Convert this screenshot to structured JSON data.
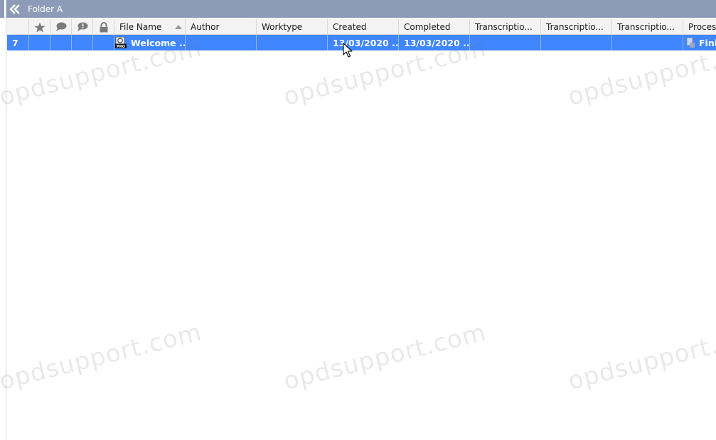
{
  "window": {
    "title": "Folder A"
  },
  "columns": [
    {
      "key": "index",
      "label": ""
    },
    {
      "key": "star",
      "label": "",
      "icon": "star-icon"
    },
    {
      "key": "comment",
      "label": "",
      "icon": "speech-bubble-icon"
    },
    {
      "key": "priority",
      "label": "",
      "icon": "exclamation-bubble-icon"
    },
    {
      "key": "lock",
      "label": "",
      "icon": "lock-icon"
    },
    {
      "key": "file_name",
      "label": "File Name"
    },
    {
      "key": "author",
      "label": "Author"
    },
    {
      "key": "worktype",
      "label": "Worktype"
    },
    {
      "key": "created",
      "label": "Created"
    },
    {
      "key": "completed",
      "label": "Completed"
    },
    {
      "key": "transcription1",
      "label": "Transcriptio..."
    },
    {
      "key": "transcription2",
      "label": "Transcriptio..."
    },
    {
      "key": "transcription3",
      "label": "Transcriptio..."
    },
    {
      "key": "process",
      "label": "Proces"
    }
  ],
  "rows": [
    {
      "index": "7",
      "file_name": "Welcome ...",
      "author": "",
      "worktype": "",
      "created": "13/03/2020 ...",
      "completed": "13/03/2020 ...",
      "transcription1": "",
      "transcription2": "",
      "transcription3": "",
      "process": "Fini",
      "selected": true
    }
  ],
  "watermark": "opdsupport.com",
  "colors": {
    "titlebar": "#8d9bb8",
    "selection": "#3f86ff",
    "header_bg": "#f3f3f3"
  }
}
